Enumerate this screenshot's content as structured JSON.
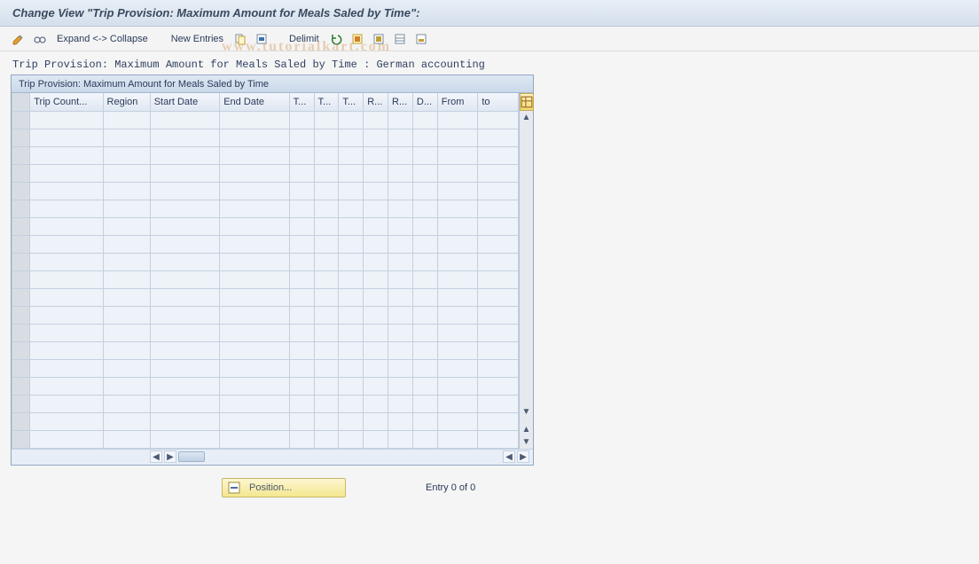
{
  "window_title": "Change View \"Trip Provision: Maximum Amount for Meals Saled by Time\":",
  "toolbar": {
    "expand_collapse": "Expand <-> Collapse",
    "new_entries": "New Entries",
    "delimit": "Delimit"
  },
  "watermark": "www.tutorialkart.com",
  "subtitle": "Trip Provision: Maximum Amount for Meals Saled by Time : German accounting",
  "grid": {
    "title": "Trip Provision: Maximum Amount for Meals Saled by Time",
    "columns": [
      "Trip Count...",
      "Region",
      "Start Date",
      "End Date",
      "T...",
      "T...",
      "T...",
      "R...",
      "R...",
      "D...",
      "From",
      "to"
    ],
    "rows": []
  },
  "footer": {
    "position_label": "Position...",
    "entry_text": "Entry 0 of 0"
  }
}
